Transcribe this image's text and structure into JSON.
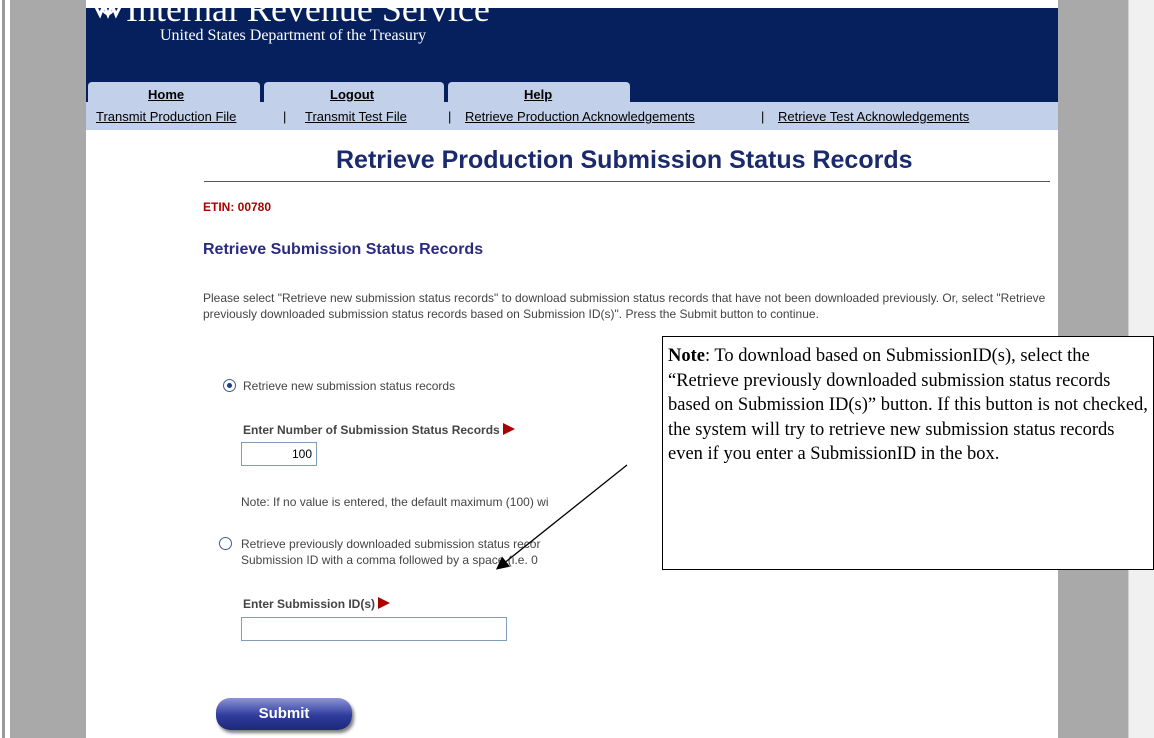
{
  "header": {
    "agency": "Internal Revenue Service",
    "department": "United States Department of the Treasury"
  },
  "tabs": [
    {
      "label": "Home"
    },
    {
      "label": "Logout"
    },
    {
      "label": "Help"
    }
  ],
  "subnav": [
    {
      "label": "Transmit Production File"
    },
    {
      "label": "Transmit Test File"
    },
    {
      "label": "Retrieve Production Acknowledgements"
    },
    {
      "label": "Retrieve Test Acknowledgements"
    }
  ],
  "page": {
    "title": "Retrieve Production Submission Status Records",
    "etin": "ETIN:  00780",
    "section_title": "Retrieve Submission Status Records",
    "intro": "Please select \"Retrieve new submission status records\" to download submission status records that have not been downloaded previously. Or, select \"Retrieve previously downloaded submission status records based on Submission ID(s)\". Press the Submit button to continue."
  },
  "options": {
    "new": {
      "label": "Retrieve new submission status records",
      "selected": true
    },
    "count_label": "Enter Number of Submission Status Records",
    "count_value": "100",
    "count_note": "Note: If no value is entered, the default maximum (100) wi",
    "previous": {
      "label_line1": "Retrieve previously downloaded submission status recor",
      "label_line2": "Submission ID with a comma followed by a space (i.e. 0",
      "selected": false
    },
    "ids_label": "Enter Submission ID(s)",
    "ids_value": ""
  },
  "submit_label": "Submit",
  "callout": {
    "bold": "Note",
    "text": ": To download based on SubmissionID(s), select the “Retrieve previously downloaded submission status records based on Submission ID(s)” button. If this button is not checked, the system will try to retrieve new submission status records even if you enter a SubmissionID in the box."
  },
  "colors": {
    "banner": "#06205e",
    "nav": "#c3d0ea",
    "title": "#1a2a6c",
    "etin": "#aa0000",
    "side": "#a9a9a9"
  }
}
